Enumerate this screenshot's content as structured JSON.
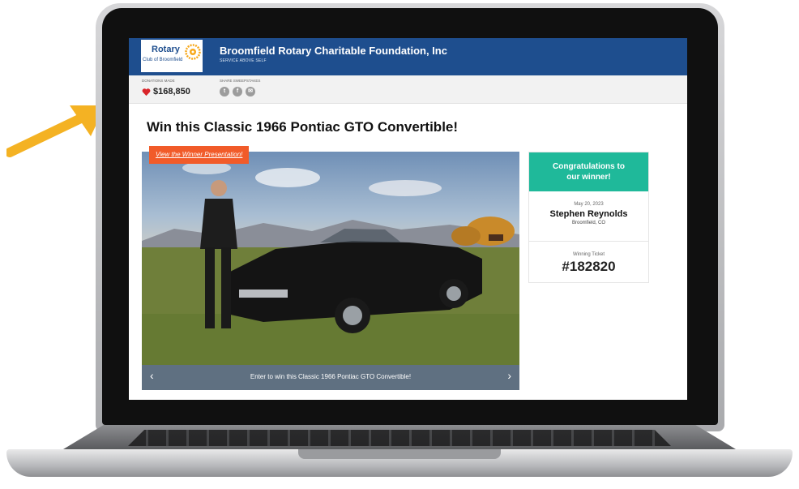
{
  "header": {
    "logo_name": "Rotary",
    "logo_sub": "Club of Broomfield",
    "org_title": "Broomfield Rotary Charitable Foundation, Inc",
    "org_motto": "SERVICE ABOVE SELF"
  },
  "stats": {
    "donations_label": "DONATIONS MADE",
    "donations_amount": "$168,850",
    "share_label": "SHARE SWEEPSTAKES",
    "share_icons": [
      "twitter-icon",
      "facebook-icon",
      "email-icon"
    ]
  },
  "main": {
    "headline": "Win this Classic 1966 Pontiac GTO Convertible!",
    "winner_button": "View the Winner Presentation!",
    "caption": "Enter to win this Classic 1966 Pontiac GTO Convertible!"
  },
  "winner_card": {
    "title": "Congratulations to our winner!",
    "date": "May 20, 2023",
    "name": "Stephen Reynolds",
    "location": "Broomfield, CO",
    "ticket_label": "Winning Ticket",
    "ticket_number": "#182820"
  },
  "colors": {
    "header_blue": "#1e4e8e",
    "accent_orange": "#f15b29",
    "winner_green": "#1fb99a",
    "caption_slate": "#5f7081",
    "arrow_yellow": "#f4b223"
  }
}
